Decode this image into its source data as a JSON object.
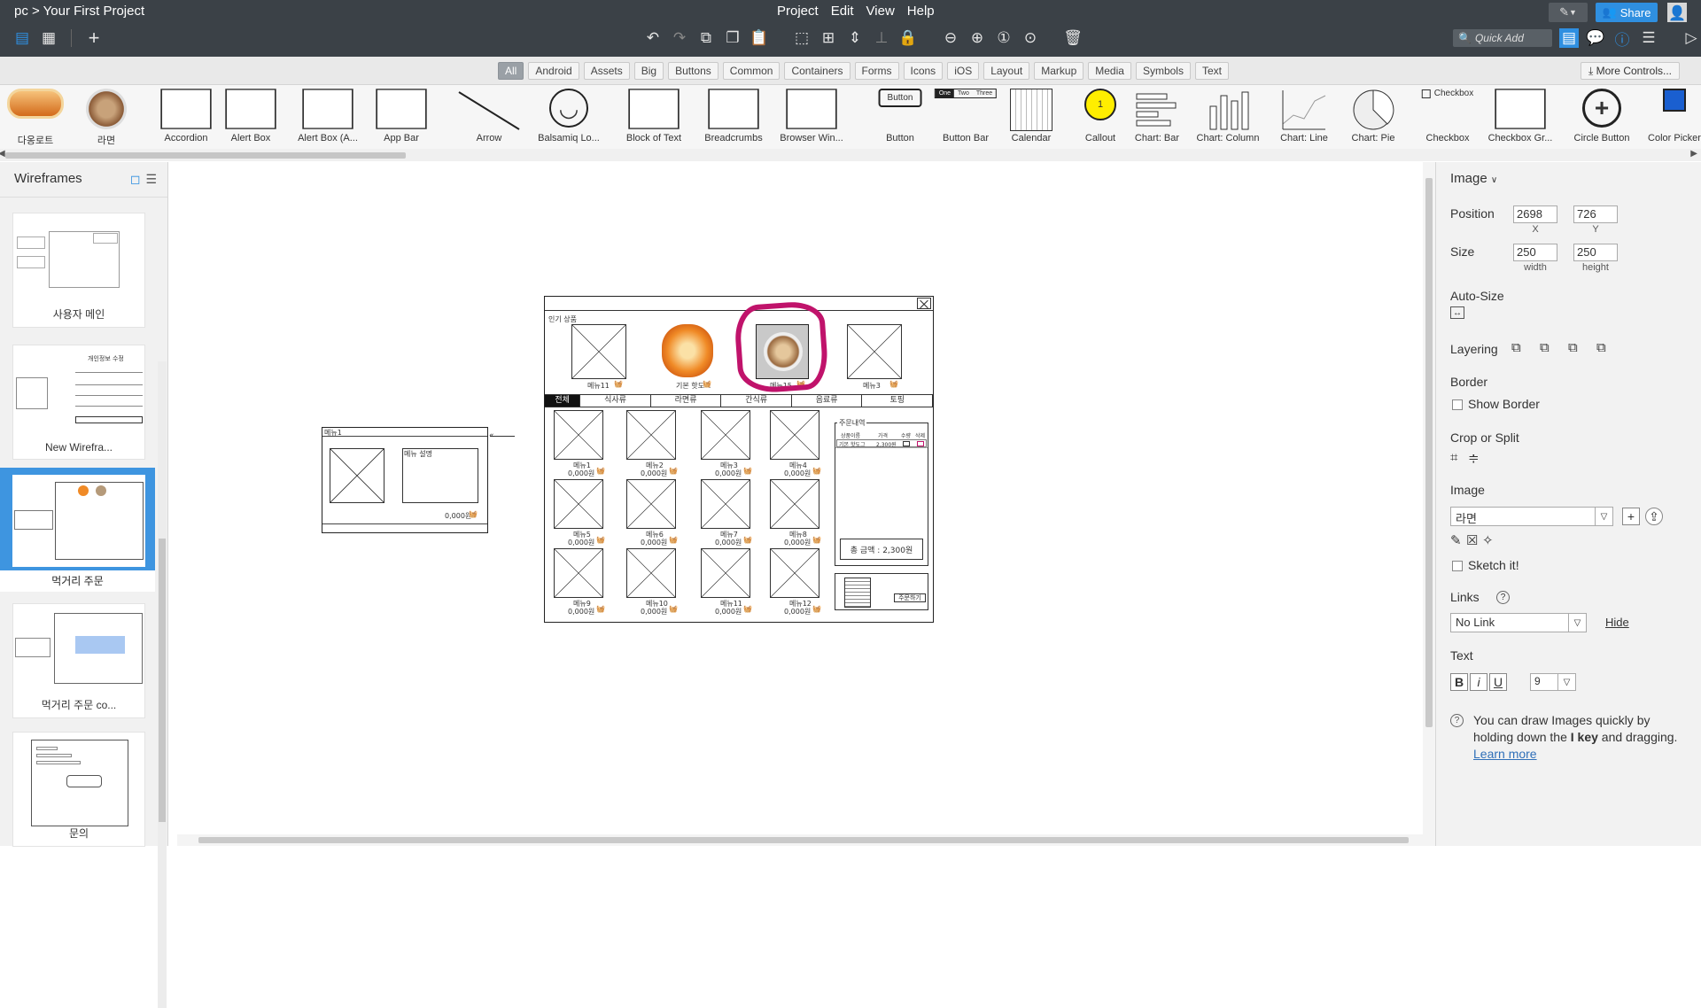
{
  "app": {
    "breadcrumb": "pc > Your First Project",
    "menus": [
      "Project",
      "Edit",
      "View",
      "Help"
    ],
    "share_label": "Share",
    "quick_add_placeholder": "Quick Add"
  },
  "categories": [
    "All",
    "Android",
    "Assets",
    "Big",
    "Buttons",
    "Common",
    "Containers",
    "Forms",
    "Icons",
    "iOS",
    "Layout",
    "Markup",
    "Media",
    "Symbols",
    "Text"
  ],
  "categories_active": "All",
  "more_controls": "More Controls...",
  "library": [
    {
      "label": "다옹로트",
      "icon": "hotdog-image"
    },
    {
      "label": "라면",
      "icon": "ramen-image"
    },
    {
      "label": "Accordion",
      "icon": "accordion-icon"
    },
    {
      "label": "Alert Box",
      "icon": "alert-box-icon"
    },
    {
      "label": "Alert Box (A...",
      "icon": "alert-box-alt-icon"
    },
    {
      "label": "App Bar",
      "icon": "app-bar-icon"
    },
    {
      "label": "Arrow",
      "icon": "arrow-icon"
    },
    {
      "label": "Balsamiq Lo...",
      "icon": "smiley-icon"
    },
    {
      "label": "Block of Text",
      "icon": "text-block-icon"
    },
    {
      "label": "Breadcrumbs",
      "icon": "breadcrumbs-icon"
    },
    {
      "label": "Browser Win...",
      "icon": "browser-window-icon"
    },
    {
      "label": "Button",
      "icon": "button-icon",
      "preview": "Button"
    },
    {
      "label": "Button Bar",
      "icon": "button-bar-icon",
      "preview": [
        "One",
        "Two",
        "Three"
      ]
    },
    {
      "label": "Calendar",
      "icon": "calendar-icon"
    },
    {
      "label": "Callout",
      "icon": "callout-icon",
      "preview": "1"
    },
    {
      "label": "Chart: Bar",
      "icon": "bar-chart-icon"
    },
    {
      "label": "Chart: Column",
      "icon": "column-chart-icon"
    },
    {
      "label": "Chart: Line",
      "icon": "line-chart-icon"
    },
    {
      "label": "Chart: Pie",
      "icon": "pie-chart-icon"
    },
    {
      "label": "Checkbox",
      "icon": "checkbox-icon",
      "preview": "Checkbox"
    },
    {
      "label": "Checkbox Gr...",
      "icon": "checkbox-group-icon"
    },
    {
      "label": "Circle Button",
      "icon": "circle-button-icon"
    },
    {
      "label": "Color Picker",
      "icon": "color-picker-icon"
    }
  ],
  "sidebar": {
    "title": "Wireframes",
    "items": [
      {
        "label": "사용자 메인",
        "selected": false
      },
      {
        "label": "New Wirefra...",
        "selected": false,
        "thumb_text": "개인정보 수정"
      },
      {
        "label": "먹거리 주문",
        "selected": true
      },
      {
        "label": "먹거리 주문 co...",
        "selected": false
      },
      {
        "label": "문의",
        "selected": false
      }
    ]
  },
  "mockup": {
    "popular_label": "인기 상품",
    "popular_items": [
      {
        "label": "메뉴11",
        "image": "placeholder"
      },
      {
        "label": "기본 핫도그",
        "image": "hotdog"
      },
      {
        "label": "메뉴15",
        "image": "ramen"
      },
      {
        "label": "메뉴3",
        "image": "placeholder"
      }
    ],
    "tabs": [
      "전체",
      "식사류",
      "라면류",
      "간식류",
      "음료류",
      "토핑"
    ],
    "menu_items": [
      {
        "label": "메뉴1",
        "price": "0,000원"
      },
      {
        "label": "메뉴2",
        "price": "0,000원"
      },
      {
        "label": "메뉴3",
        "price": "0,000원"
      },
      {
        "label": "메뉴4",
        "price": "0,000원"
      },
      {
        "label": "메뉴5",
        "price": "0,000원"
      },
      {
        "label": "메뉴6",
        "price": "0,000원"
      },
      {
        "label": "메뉴7",
        "price": "0,000원"
      },
      {
        "label": "메뉴8",
        "price": "0,000원"
      },
      {
        "label": "메뉴9",
        "price": "0,000원"
      },
      {
        "label": "메뉴10",
        "price": "0,000원"
      },
      {
        "label": "메뉴11",
        "price": "0,000원"
      },
      {
        "label": "메뉴12",
        "price": "0,000원"
      }
    ],
    "order": {
      "title": "주문내역",
      "headers": [
        "상품이름",
        "가격",
        "수량",
        "삭제"
      ],
      "row": {
        "name": "기본 핫도그",
        "price": "2,300원"
      },
      "total": "총 금액 : 2,300원",
      "order_button": "주문하기"
    },
    "side_card": {
      "title": "메뉴1",
      "desc": "메뉴 설명",
      "price": "0,000원"
    }
  },
  "panel": {
    "title": "Image",
    "position_label": "Position",
    "x": "2698",
    "y": "726",
    "x_sub": "X",
    "y_sub": "Y",
    "size_label": "Size",
    "width": "250",
    "height": "250",
    "w_sub": "width",
    "h_sub": "height",
    "autosize_label": "Auto-Size",
    "layering_label": "Layering",
    "border_label": "Border",
    "show_border": "Show Border",
    "crop_label": "Crop or Split",
    "image_label": "Image",
    "image_value": "라면",
    "sketch_label": "Sketch it!",
    "links_label": "Links",
    "link_value": "No Link",
    "hide_label": "Hide",
    "text_label": "Text",
    "font_size": "9",
    "hint_a": "You can draw Images quickly by holding down the ",
    "hint_key": "I key",
    "hint_b": " and dragging. ",
    "hint_link": "Learn more"
  },
  "colors": {
    "topbar": "#3b4147",
    "accent": "#2f8fe0",
    "selection": "#c0136b",
    "sidebar_sel": "#3e95e0"
  }
}
